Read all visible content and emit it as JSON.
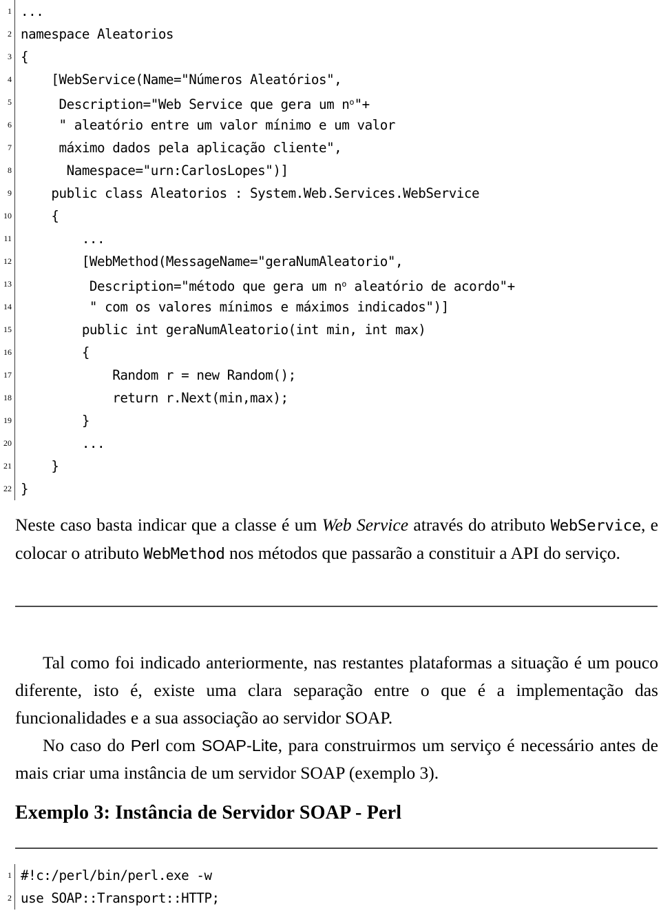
{
  "document": {
    "language": "pt",
    "code_block_top": {
      "name": "csharp-webservice-listing",
      "lines": [
        {
          "number": "1",
          "text": "..."
        },
        {
          "number": "2",
          "text": "namespace Aleatorios"
        },
        {
          "number": "3",
          "text": "{"
        },
        {
          "number": "4",
          "text": "    [WebService(Name=\"Números Aleatórios\","
        },
        {
          "number": "5",
          "text": "     Description=\"Web Service que gera um n",
          "sup": "o",
          "text_after": "\"+"
        },
        {
          "number": "6",
          "text": "     \" aleatório entre um valor mínimo e um valor"
        },
        {
          "number": "7",
          "text": "     máximo dados pela aplicação cliente\","
        },
        {
          "number": "8",
          "text": "      Namespace=\"urn:CarlosLopes\")]"
        },
        {
          "number": "9",
          "text": "    public class Aleatorios : System.Web.Services.WebService"
        },
        {
          "number": "10",
          "text": "    {"
        },
        {
          "number": "11",
          "text": "        ..."
        },
        {
          "number": "12",
          "text": "        [WebMethod(MessageName=\"geraNumAleatorio\","
        },
        {
          "number": "13",
          "text": "         Description=\"método que gera um n",
          "sup": "o",
          "text_after": " aleatório de acordo\"+"
        },
        {
          "number": "14",
          "text": "         \" com os valores mínimos e máximos indicados\")]"
        },
        {
          "number": "15",
          "text": "        public int geraNumAleatorio(int min, int max)"
        },
        {
          "number": "16",
          "text": "        {"
        },
        {
          "number": "17",
          "text": "            Random r = new Random();"
        },
        {
          "number": "18",
          "text": "            return r.Next(min,max);"
        },
        {
          "number": "19",
          "text": "        }"
        },
        {
          "number": "20",
          "text": "        ..."
        },
        {
          "number": "21",
          "text": "    }"
        },
        {
          "number": "22",
          "text": "}"
        }
      ]
    },
    "paragraph_1": {
      "part_1": "Neste caso basta indicar que a classe é um ",
      "italic_1": "Web Service",
      "part_2": " através do atributo ",
      "mono_1": "WebService",
      "part_3": ", e colocar o atributo ",
      "mono_2": "WebMethod",
      "part_4": " nos métodos que passarão a constituir a API do serviço."
    },
    "paragraph_2": {
      "text": "Tal como foi indicado anteriormente, nas restantes plataformas a situação é um pouco diferente, isto é, existe uma clara separação entre o que é a implementação das funcionalidades e a sua associação ao servidor SOAP."
    },
    "paragraph_3": {
      "part_1": "No caso do ",
      "sans_1": "Perl",
      "part_2": " com ",
      "sans_2": "SOAP-Lite",
      "part_3": ", para construirmos um serviço é necessário antes de mais criar uma instância de um servidor SOAP (exemplo 3)."
    },
    "heading_example_3": "Exemplo 3: Instância de Servidor SOAP - Perl",
    "code_block_bottom": {
      "name": "perl-soap-listing",
      "lines": [
        {
          "number": "1",
          "text": "#!c:/perl/bin/perl.exe -w"
        },
        {
          "number": "2",
          "text": "use SOAP::Transport::HTTP;"
        }
      ]
    },
    "colors": {
      "text": "#000000",
      "rule": "#4a4a4a",
      "background": "#ffffff"
    }
  }
}
